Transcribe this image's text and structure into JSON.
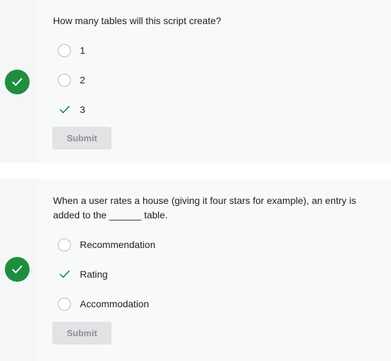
{
  "questions": [
    {
      "text": "How many tables will this script create?",
      "status_icon": "check-circle-icon",
      "options": [
        {
          "label": "1",
          "state": "unselected"
        },
        {
          "label": "2",
          "state": "unselected"
        },
        {
          "label": "3",
          "state": "correct"
        }
      ],
      "submit_label": "Submit"
    },
    {
      "text": "When a user rates a house (giving it four stars for example), an entry is added to the ______ table.",
      "status_icon": "check-circle-icon",
      "options": [
        {
          "label": "Recommendation",
          "state": "unselected"
        },
        {
          "label": "Rating",
          "state": "correct"
        },
        {
          "label": "Accommodation",
          "state": "unselected"
        }
      ],
      "submit_label": "Submit"
    }
  ],
  "colors": {
    "card_bg": "#f8f9fa",
    "correct_green": "#1e8e3e",
    "radio_border": "#b8babd",
    "submit_bg": "#e2e3e4",
    "submit_text": "#8d9094"
  }
}
